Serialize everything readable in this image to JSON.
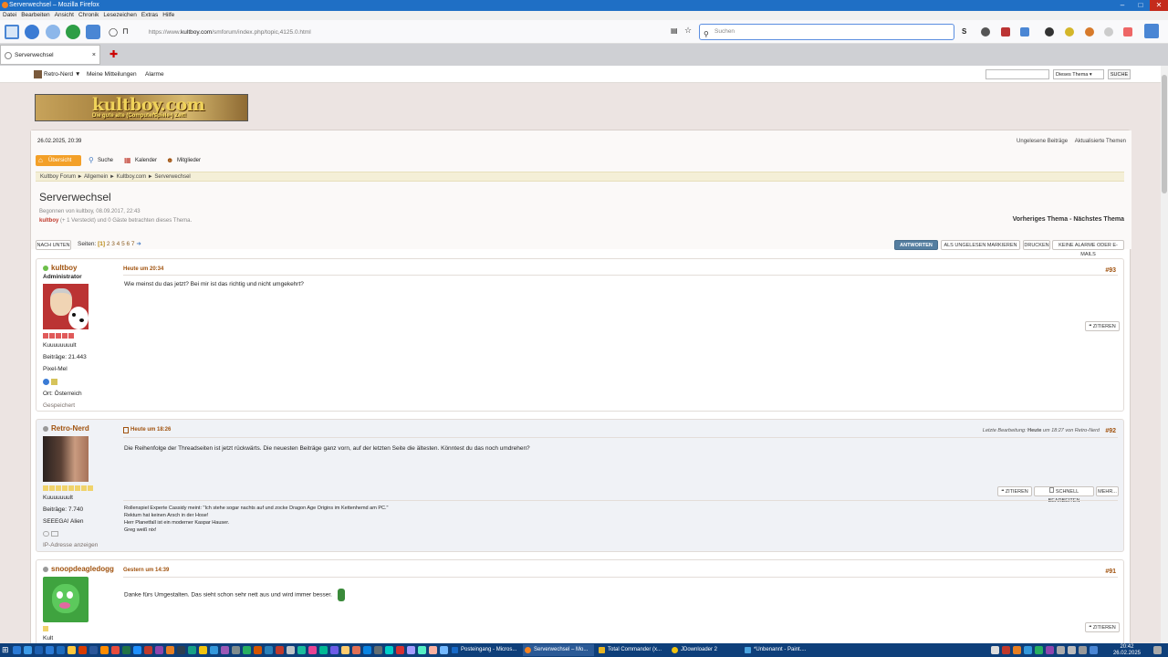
{
  "window": {
    "title": "Serverwechsel – Mozilla Firefox"
  },
  "menubar": [
    "Datei",
    "Bearbeiten",
    "Ansicht",
    "Chronik",
    "Lesezeichen",
    "Extras",
    "Hilfe"
  ],
  "browser": {
    "url_prefix": "https://www.",
    "url_domain": "kultboy.com",
    "url_path": "/smforum/index.php/topic,4125.0.html",
    "search_placeholder": "Suchen",
    "tab_title": "Serverwechsel",
    "tab_close": "×",
    "newtab": "✚"
  },
  "forum": {
    "topbar": {
      "user": "Retro-Nerd ▼",
      "messages": "Meine Mitteilungen",
      "alerts": "Alarme",
      "scope": "Dieses Thema",
      "search_button": "SUCHE"
    },
    "banner": {
      "logo": "kultboy.com",
      "tagline": "Die gute alte (Computerspiele-) Zeit!"
    },
    "date": "26.02.2025, 20:39",
    "right_links": [
      "Ungelesene Beiträge",
      "Aktualisierte Themen"
    ],
    "menu": [
      "Übersicht",
      "Suche",
      "Kalender",
      "Mitglieder"
    ],
    "breadcrumb": "Kultboy Forum  ►  Allgemein  ►  Kultboy.com  ►  Serverwechsel",
    "thread": {
      "title": "Serverwechsel",
      "started": "Begonnen von kultboy, 08.09.2017, 22:43",
      "viewer_name": "kultboy",
      "viewers_rest": " (+ 1 Versteckt) und 0 Gäste betrachten dieses Thema.",
      "prevnext": "Vorheriges Thema - Nächstes Thema"
    },
    "pager": {
      "down": "NACH UNTEN",
      "label": "Seiten:",
      "current": "[1]",
      "pages": "2 3 4 5 6 7",
      "arrow": "➜"
    },
    "actions": [
      "ANTWORTEN",
      "ALS UNGELESEN MARKIEREN",
      "DRUCKEN",
      "KEINE ALARME ODER E-MAILS"
    ],
    "posts": [
      {
        "name": "kultboy",
        "role": "Administrator",
        "rank": "Kuuuuuuuult",
        "posts": "Beiträge: 21.443",
        "custom": "Pixel-Mel",
        "location": "Ort: Österreich",
        "saved": "Gespeichert",
        "time": "Heute um 20:34",
        "number": "#93",
        "body": "Wie meinst du das jetzt? Bei mir ist das richtig und nicht umgekehrt?",
        "quote": "ZITIEREN"
      },
      {
        "name": "Retro-Nerd",
        "rank": "Kuuuuuuult",
        "posts": "Beiträge: 7.740",
        "custom": "SEEEGA! Alien",
        "ip": "IP-Adresse anzeigen",
        "time": "Heute um 18:26",
        "edited_prefix": "Letzte Bearbeitung: ",
        "edited_when": "Heute",
        "edited_suffix": " um 18:27 von Retro-Nerd",
        "number": "#92",
        "body": "Die Reihenfolge der Threadseiten ist jetzt rückwärts. Die neuesten Beiträge ganz vorn, auf der letzten Seite die ältesten. Könntest du das noch umdrehen?",
        "buttons": [
          "ZITIEREN",
          "SCHNELL BEARBEITEN",
          "MEHR..."
        ],
        "signature": [
          "Rollenspiel Experte Cassidy meint: \"Ich stehe sogar nachts auf und zocke Dragon Age Origins im Kettenhemd am PC.\"",
          "Rektum hat keinen Arsch in der Hose!",
          "Herr Planetfall ist ein moderner Kaspar Hauser.",
          "Greg weiß nix!"
        ]
      },
      {
        "name": "snoopdeagledogg",
        "rank": "Kult",
        "time": "Gestern um 14:39",
        "number": "#91",
        "body": "Danke fürs Umgestalten. Das sieht schon sehr nett aus und wird immer besser.",
        "quote": "ZITIEREN"
      }
    ]
  },
  "taskbar": {
    "tasks": [
      "Posteingang - Micros...",
      "Serverwechsel – Mo...",
      "Total Commander (x...",
      "JDownloader 2",
      "*Unbenannt - Paint...."
    ],
    "time": "20:42",
    "date": "26.02.2025"
  },
  "colors": {
    "accent": "#f3a028",
    "link": "#a0520e",
    "primary_button": "#557ea0",
    "titlebar": "#1f6fc5",
    "taskbar": "#0e3f7a"
  }
}
